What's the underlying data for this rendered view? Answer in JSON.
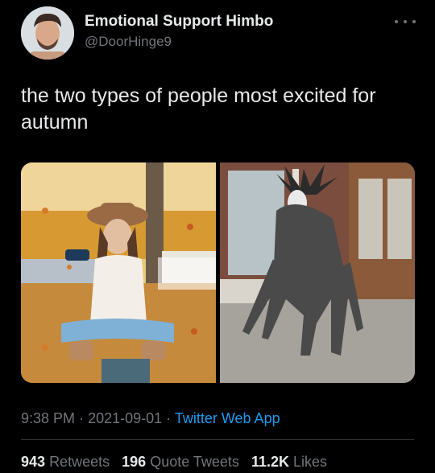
{
  "tweet": {
    "author_name": "Emotional Support Himbo",
    "author_handle": "@DoorHinge9",
    "text": "the two types of people most excited for autumn",
    "time": "9:38 PM",
    "date": "2021-09-01",
    "source": "Twitter Web App",
    "sep": "·"
  },
  "stats": {
    "retweets_count": "943",
    "retweets_label": "Retweets",
    "quote_count": "196",
    "quote_label": "Quote Tweets",
    "likes_count": "11.2K",
    "likes_label": "Likes"
  },
  "colors": {
    "background": "#000000",
    "text": "#e7e9ea",
    "muted": "#71767b",
    "link": "#1d9bf0"
  },
  "icons": [
    "more-icon"
  ]
}
